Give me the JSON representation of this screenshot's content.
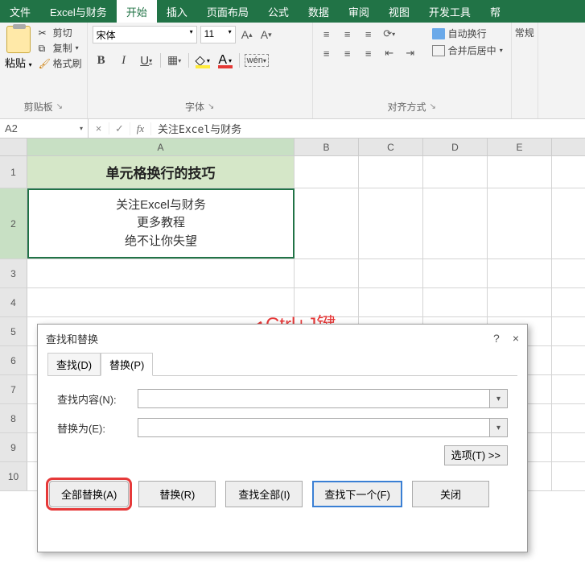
{
  "ribbon": {
    "tabs": [
      "文件",
      "Excel与财务",
      "开始",
      "插入",
      "页面布局",
      "公式",
      "数据",
      "审阅",
      "视图",
      "开发工具",
      "帮"
    ],
    "active_tab": "开始",
    "clipboard": {
      "paste": "粘贴",
      "cut": "剪切",
      "copy": "复制",
      "format_painter": "格式刷",
      "group_label": "剪贴板"
    },
    "font": {
      "name": "宋体",
      "size": "11",
      "bold": "B",
      "italic": "I",
      "underline": "U",
      "wen": "wén",
      "fill_letter": "A",
      "font_letter": "A",
      "group_label": "字体"
    },
    "align": {
      "wrap": "自动换行",
      "merge": "合并后居中",
      "group_label": "对齐方式"
    },
    "extra": "常规"
  },
  "formula_bar": {
    "name_box": "A2",
    "fx": "fx",
    "content": "关注Excel与财务"
  },
  "columns": [
    "A",
    "B",
    "C",
    "D",
    "E"
  ],
  "rows": {
    "r1": {
      "num": "1",
      "A": "单元格换行的技巧"
    },
    "r2": {
      "num": "2",
      "A_lines": [
        "关注Excel与财务",
        "更多教程",
        "绝不让你失望"
      ]
    },
    "nums": [
      "3",
      "4",
      "5",
      "6",
      "7",
      "8",
      "9",
      "10"
    ]
  },
  "dialog": {
    "title": "查找和替换",
    "help": "?",
    "close": "×",
    "tab_find": "查找(D)",
    "tab_replace": "替换(P)",
    "find_label": "查找内容(N):",
    "replace_label": "替换为(E):",
    "options": "选项(T) >>",
    "btn_replace_all": "全部替换(A)",
    "btn_replace": "替换(R)",
    "btn_find_all": "查找全部(I)",
    "btn_find_next": "查找下一个(F)",
    "btn_close": "关闭"
  },
  "annotation": {
    "text": "Ctrl+J键"
  }
}
